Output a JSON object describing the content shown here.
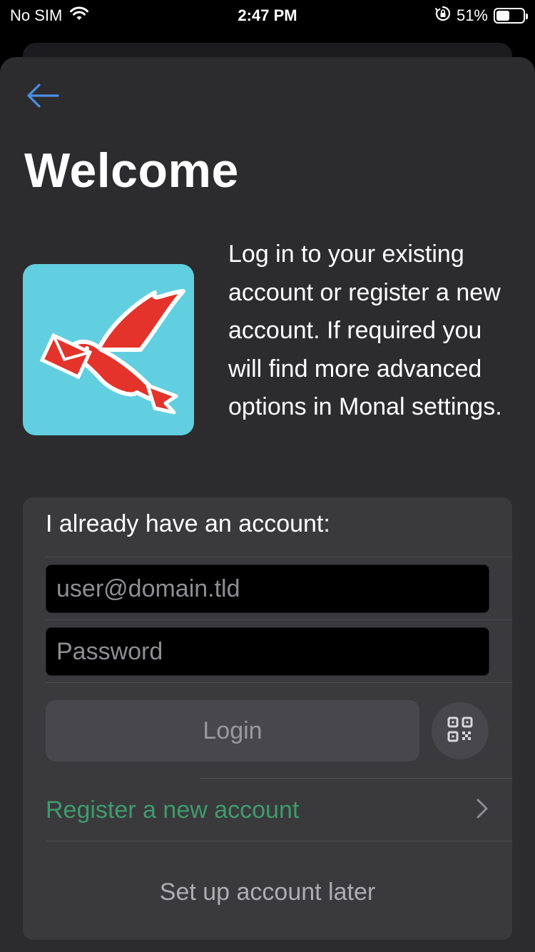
{
  "status_bar": {
    "carrier": "No SIM",
    "time": "2:47 PM",
    "battery_percent": "51%",
    "battery_level": 0.51,
    "icons": [
      "wifi-icon",
      "orientation-lock-icon",
      "battery-icon"
    ]
  },
  "header": {
    "back_icon": "arrow-left-icon",
    "title": "Welcome"
  },
  "intro": {
    "logo_icon": "monal-dove-logo",
    "text": "Log in to your existing account or register a new account. If required you will find more advanced options in Monal settings."
  },
  "login_card": {
    "heading": "I already have an account:",
    "username": {
      "value": "",
      "placeholder": "user@domain.tld"
    },
    "password": {
      "value": "",
      "placeholder": "Password"
    },
    "login_label": "Login",
    "qr_icon": "qr-code-icon",
    "register_label": "Register a new account",
    "register_icon": "chevron-right-icon",
    "later_label": "Set up account later"
  },
  "colors": {
    "background": "#2c2c2e",
    "card": "#3a3a3c",
    "accent_blue": "#4a90e2",
    "accent_green": "#3f9b6e",
    "logo_bg": "#62cfe0",
    "logo_red": "#e4332a"
  }
}
